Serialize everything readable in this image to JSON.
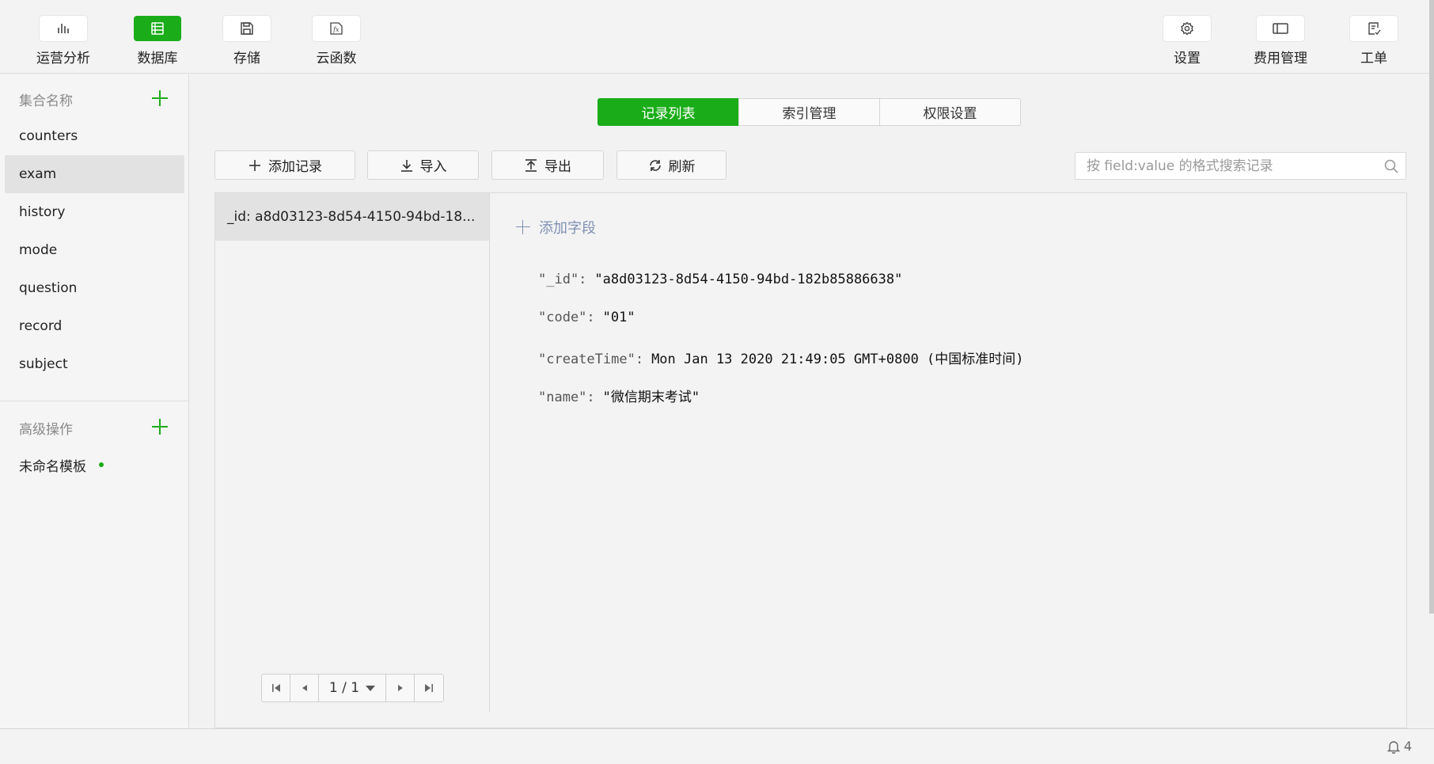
{
  "toolbar": {
    "left": [
      {
        "label": "运营分析",
        "icon": "bar-chart-icon"
      },
      {
        "label": "数据库",
        "icon": "database-icon"
      },
      {
        "label": "存储",
        "icon": "save-icon"
      },
      {
        "label": "云函数",
        "icon": "function-icon"
      }
    ],
    "right": [
      {
        "label": "设置",
        "icon": "gear-icon"
      },
      {
        "label": "费用管理",
        "icon": "wallet-icon"
      },
      {
        "label": "工单",
        "icon": "ticket-icon"
      }
    ],
    "active": "数据库",
    "accent": "#1aad19"
  },
  "sidebar": {
    "collections_header": "集合名称",
    "collections": [
      "counters",
      "exam",
      "history",
      "mode",
      "question",
      "record",
      "subject"
    ],
    "selected": "exam",
    "advanced_header": "高级操作",
    "templates": [
      "未命名模板"
    ]
  },
  "tabs": [
    "记录列表",
    "索引管理",
    "权限设置"
  ],
  "active_tab": "记录列表",
  "actions": {
    "add": "添加记录",
    "import": "导入",
    "export": "导出",
    "refresh": "刷新"
  },
  "search": {
    "placeholder": "按 field:value 的格式搜索记录",
    "value": ""
  },
  "records": [
    {
      "label": "_id: a8d03123-8d54-4150-94bd-18..."
    }
  ],
  "pager": {
    "text": "1 / 1"
  },
  "detail": {
    "add_field": "添加字段",
    "fields": [
      {
        "key": "\"_id\":",
        "value": "\"a8d03123-8d54-4150-94bd-182b85886638\""
      },
      {
        "key": "\"code\":",
        "value": "\"01\""
      },
      {
        "key": "\"createTime\":",
        "value": "Mon Jan 13 2020 21:49:05 GMT+0800 (中国标准时间)"
      },
      {
        "key": "\"name\":",
        "value": "\"微信期末考试\""
      }
    ]
  },
  "status": {
    "notifications": "4"
  }
}
